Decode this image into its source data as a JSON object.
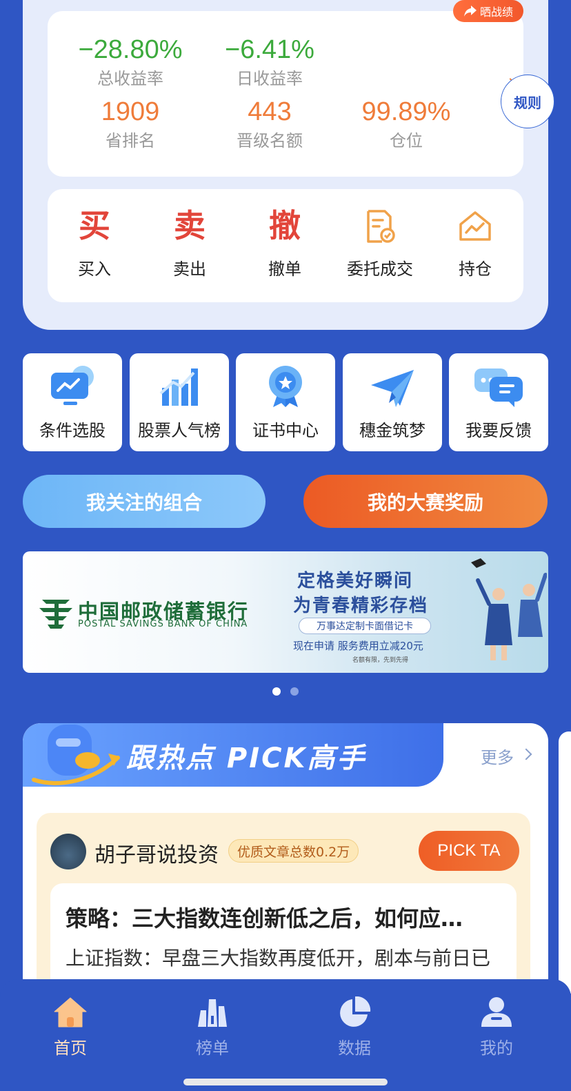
{
  "share_badge": "晒战绩",
  "stats": {
    "total_return": {
      "value": "−28.80%",
      "label": "总收益率"
    },
    "daily_return": {
      "value": "−6.41%",
      "label": "日收益率"
    },
    "province_rank": {
      "value": "1909",
      "label": "省排名"
    },
    "promotion_quota": {
      "value": "443",
      "label": "晋级名额"
    },
    "position": {
      "value": "99.89%",
      "label": "仓位"
    }
  },
  "rule_button": "规则",
  "trade_actions": [
    {
      "glyph": "买",
      "label": "买入",
      "icon": "buy-icon"
    },
    {
      "glyph": "卖",
      "label": "卖出",
      "icon": "sell-icon"
    },
    {
      "glyph": "撤",
      "label": "撤单",
      "icon": "cancel-order-icon"
    },
    {
      "glyph": "",
      "label": "委托成交",
      "icon": "order-document-icon"
    },
    {
      "glyph": "",
      "label": "持仓",
      "icon": "holdings-house-icon"
    }
  ],
  "tools": [
    {
      "label": "条件选股",
      "icon": "monitor-chart-icon"
    },
    {
      "label": "股票人气榜",
      "icon": "bar-chart-icon"
    },
    {
      "label": "证书中心",
      "icon": "medal-icon"
    },
    {
      "label": "穗金筑梦",
      "icon": "paper-plane-icon"
    },
    {
      "label": "我要反馈",
      "icon": "chat-bubble-icon"
    }
  ],
  "buttons": {
    "followed_portfolio": "我关注的组合",
    "my_rewards": "我的大赛奖励"
  },
  "banner": {
    "bank_name": "中国邮政储蓄银行",
    "bank_name_en": "POSTAL SAVINGS BANK OF CHINA",
    "headline_1": "定格美好瞬间",
    "headline_2": "为青春精彩存档",
    "tag": "万事达定制卡面借记卡",
    "sub": "现在申请 服务费用立减20元",
    "note": "名额有限，先到先得",
    "dots": 2,
    "active_dot": 0
  },
  "pick": {
    "title": "跟热点 PICK高手",
    "more": "更多",
    "author": "胡子哥说投资",
    "author_tag": "优质文章总数0.2万",
    "pick_button": "PICK TA",
    "article_title": "策略：三大指数连创新低之后，如何应…",
    "article_body": "上证指数：早盘三大指数再度低开，剧本与前日已基本一致，三大指数持续冲高，半导体..."
  },
  "tabs": [
    {
      "label": "首页",
      "icon": "home-icon",
      "active": true
    },
    {
      "label": "榜单",
      "icon": "ranking-icon",
      "active": false
    },
    {
      "label": "数据",
      "icon": "pie-chart-icon",
      "active": false
    },
    {
      "label": "我的",
      "icon": "user-icon",
      "active": false
    }
  ],
  "colors": {
    "background": "#2f56c4",
    "negative": "#3caa3c",
    "accent_orange": "#ef7c3a",
    "action_red": "#e2453a"
  }
}
